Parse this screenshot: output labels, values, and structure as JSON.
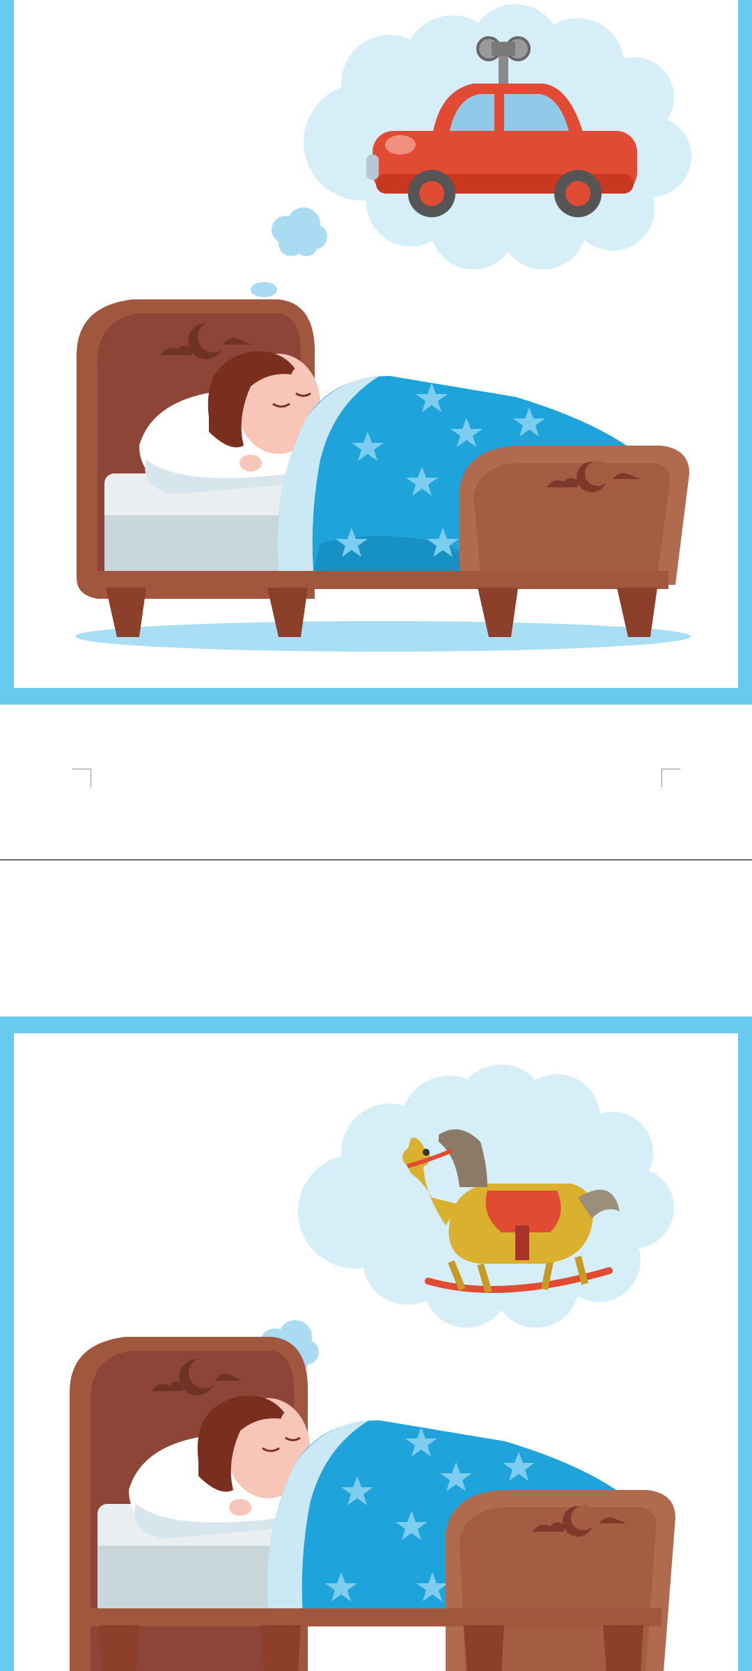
{
  "document": {
    "pages": [
      {
        "illustration": "boy-sleeping-dreaming-of-toy-car"
      },
      {
        "illustration": "boy-sleeping-dreaming-of-rocking-horse"
      }
    ],
    "colors": {
      "frame": "#66cbee",
      "page_background": "#ffffff",
      "page_separator": "#6f6f6f",
      "bed_wood": "#a0573d",
      "blanket": "#1ea3db",
      "dream_cloud": "#d6eef8",
      "toy_car": "#e24b33",
      "rocking_horse": "#d9b12e"
    }
  }
}
